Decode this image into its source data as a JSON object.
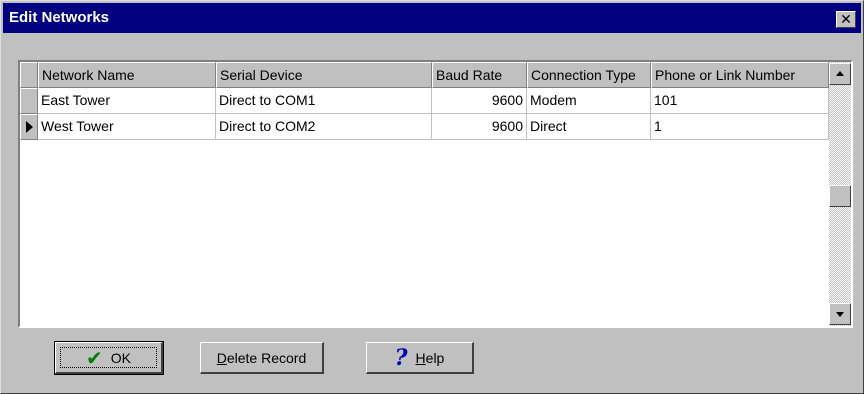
{
  "window": {
    "title": "Edit Networks",
    "close_glyph": "✕"
  },
  "grid": {
    "columns": [
      "Network Name",
      "Serial Device",
      "Baud Rate",
      "Connection Type",
      "Phone or Link Number"
    ],
    "rows": [
      {
        "current": false,
        "network_name": "East Tower",
        "serial_device": "Direct to COM1",
        "baud_rate": "9600",
        "connection_type": "Modem",
        "phone_or_link_number": "101"
      },
      {
        "current": true,
        "network_name": "West Tower",
        "serial_device": "Direct to COM2",
        "baud_rate": "9600",
        "connection_type": "Direct",
        "phone_or_link_number": "1"
      }
    ],
    "scroll_position": 0.5
  },
  "buttons": {
    "ok": {
      "label": "OK",
      "icon": "check-icon",
      "icon_color": "#008000"
    },
    "delete": {
      "label_underlined": "D",
      "label_rest": "elete Record"
    },
    "help": {
      "label_underlined": "H",
      "label_rest": "elp",
      "icon": "help-icon",
      "icon_color": "#0000c0"
    }
  },
  "colors": {
    "titlebar": "#000080",
    "face": "#c0c0c0",
    "grid_bg": "#ffffff"
  }
}
